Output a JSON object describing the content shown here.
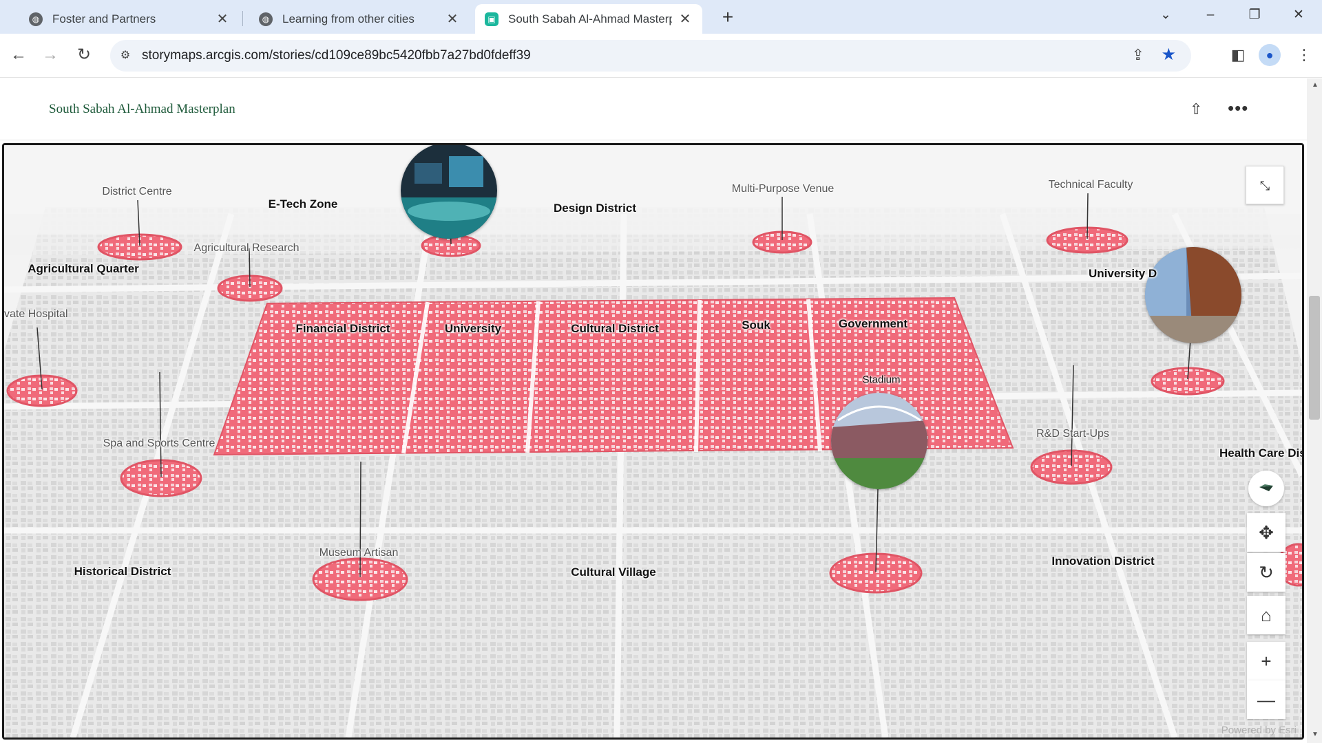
{
  "browser": {
    "tabs": [
      {
        "title": "Foster and Partners",
        "active": false,
        "icon": "globe-icon"
      },
      {
        "title": "Learning from other cities",
        "active": false,
        "icon": "globe-icon"
      },
      {
        "title": "South Sabah Al-Ahmad Masterp",
        "active": true,
        "icon": "storymaps-icon"
      }
    ],
    "url": "storymaps.arcgis.com/stories/cd109ce89bc5420fbb7a27bd0fdeff39",
    "bookmarked": true
  },
  "story": {
    "title": "South Sabah Al-Ahmad Masterplan"
  },
  "map": {
    "labels": {
      "district_centre": "District Centre",
      "etech_zone": "E-Tech Zone",
      "design_district": "Design District",
      "multi_purpose_venue": "Multi-Purpose Venue",
      "technical_faculty": "Technical Faculty",
      "agricultural_research": "Agricultural Research",
      "agricultural_quarter": "Agricultural Quarter",
      "university_right": "University D",
      "private_hospital": "vate Hospital",
      "financial_district": "Financial District",
      "university": "University",
      "cultural_district": "Cultural District",
      "souk": "Souk",
      "government": "Government",
      "stadium": "Stadium",
      "spa_sports": "Spa and Sports Centre",
      "rd_startups": "R&D Start-Ups",
      "health_care": "Health Care Dist",
      "museum_artisan": "Museum Artisan",
      "historical_district": "Historical District",
      "cultural_village": "Cultural Village",
      "innovation_district": "Innovation District"
    },
    "attribution": "Powered by Esri",
    "highlight_color": "#f06a7a",
    "base_color": "#e8e8e8"
  }
}
